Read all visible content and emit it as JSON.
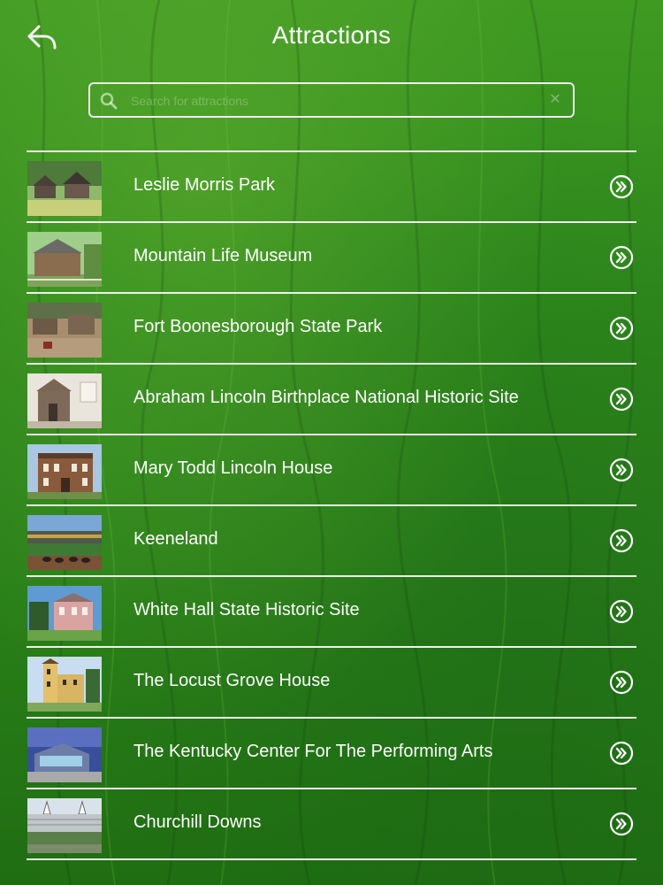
{
  "header": {
    "title": "Attractions"
  },
  "search": {
    "placeholder": "Search for attractions",
    "value": ""
  },
  "attractions": [
    {
      "name": "Leslie Morris Park",
      "thumb": "log-cabins"
    },
    {
      "name": "Mountain Life Museum",
      "thumb": "log-house"
    },
    {
      "name": "Fort Boonesborough State Park",
      "thumb": "fort-village"
    },
    {
      "name": "Abraham Lincoln Birthplace National Historic Site",
      "thumb": "cabin-interior"
    },
    {
      "name": "Mary Todd Lincoln House",
      "thumb": "brick-house"
    },
    {
      "name": "Keeneland",
      "thumb": "racetrack"
    },
    {
      "name": "White Hall State Historic Site",
      "thumb": "mansion"
    },
    {
      "name": "The Locust Grove House",
      "thumb": "tower-house"
    },
    {
      "name": "The Kentucky Center For The Performing Arts",
      "thumb": "modern-building"
    },
    {
      "name": "Churchill Downs",
      "thumb": "grandstand"
    }
  ],
  "colors": {
    "background": "#2f8a1c",
    "line": "#eef2ea",
    "text": "#ffffff"
  }
}
